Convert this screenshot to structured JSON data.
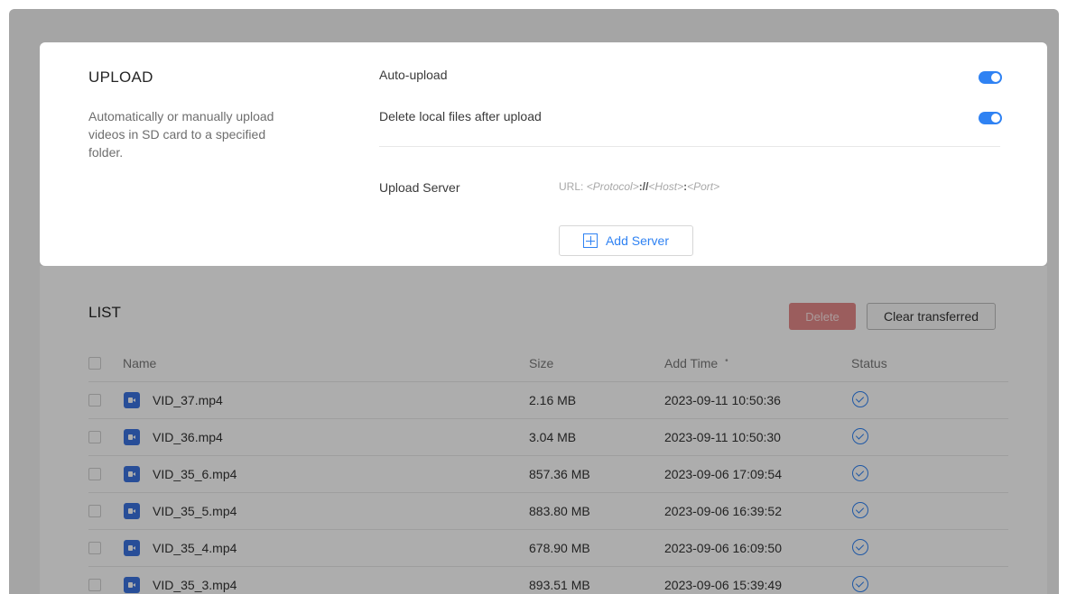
{
  "upload": {
    "title": "UPLOAD",
    "description": "Automatically or manually upload videos in SD card to a specified folder.",
    "auto_upload_label": "Auto-upload",
    "auto_upload_on": true,
    "delete_local_label": "Delete local files after upload",
    "delete_local_on": true,
    "server_label": "Upload Server",
    "url_prefix": "URL: ",
    "url_protocol": "<Protocol>",
    "url_sep1": "://",
    "url_host": "<Host>",
    "url_sep2": ":",
    "url_port": "<Port>",
    "add_server_label": "Add Server"
  },
  "list": {
    "title": "LIST",
    "delete_label": "Delete",
    "clear_label": "Clear transferred",
    "columns": {
      "name": "Name",
      "size": "Size",
      "add_time": "Add Time",
      "sort_indicator": "•",
      "status": "Status"
    },
    "rows": [
      {
        "name": "VID_37.mp4",
        "size": "2.16 MB",
        "time": "2023-09-11 10:50:36"
      },
      {
        "name": "VID_36.mp4",
        "size": "3.04 MB",
        "time": "2023-09-11 10:50:30"
      },
      {
        "name": "VID_35_6.mp4",
        "size": "857.36 MB",
        "time": "2023-09-06 17:09:54"
      },
      {
        "name": "VID_35_5.mp4",
        "size": "883.80 MB",
        "time": "2023-09-06 16:39:52"
      },
      {
        "name": "VID_35_4.mp4",
        "size": "678.90 MB",
        "time": "2023-09-06 16:09:50"
      },
      {
        "name": "VID_35_3.mp4",
        "size": "893.51 MB",
        "time": "2023-09-06 15:39:49"
      }
    ]
  },
  "colors": {
    "accent": "#2f82f3",
    "delete": "#e58a8a",
    "overlay": "rgba(0,0,0,0.32)"
  },
  "icons": {
    "add": "plus-square-icon",
    "file": "video-file-icon",
    "status": "check-circle-icon"
  }
}
